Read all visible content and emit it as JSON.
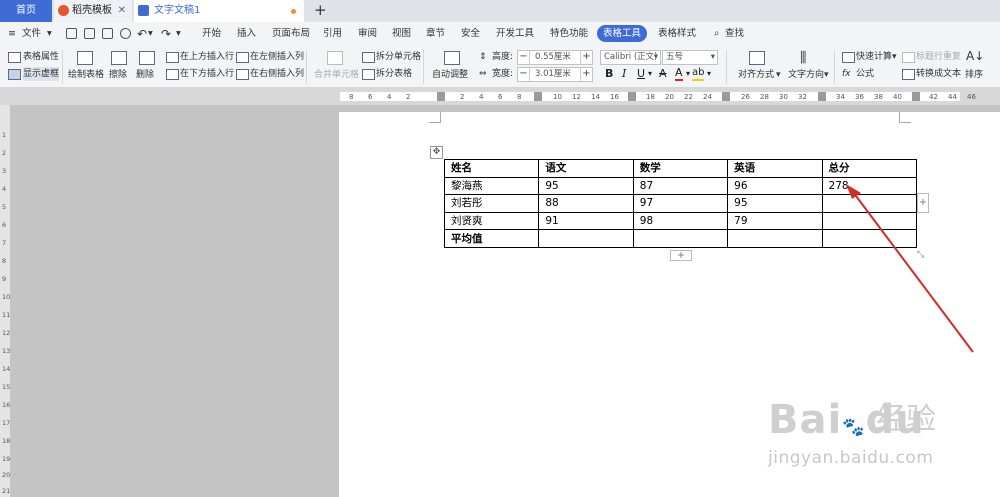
{
  "tabs": {
    "home": "首页",
    "template": "稻壳模板",
    "doc": "文字文稿1"
  },
  "menu": {
    "file": "文件",
    "items": [
      "开始",
      "插入",
      "页面布局",
      "引用",
      "审阅",
      "视图",
      "章节",
      "安全",
      "开发工具",
      "特色功能",
      "表格工具",
      "表格样式"
    ],
    "search": "查找"
  },
  "ribbon": {
    "table_props": "表格属性",
    "show_grid": "显示虚框",
    "draw_table": "绘制表格",
    "erase": "擦除",
    "delete": "删除",
    "insert_above": "在上方插入行",
    "insert_below": "在下方插入行",
    "insert_left": "在左侧插入列",
    "insert_right": "在右侧插入列",
    "merge_cells": "合并单元格",
    "split_cells": "拆分单元格",
    "split_table": "拆分表格",
    "auto_fit": "自动调整",
    "height_label": "高度:",
    "height_value": "0.55厘米",
    "width_label": "宽度:",
    "width_value": "3.01厘米",
    "font_name": "Calibri (正文)",
    "font_size": "五号",
    "align": "对齐方式",
    "text_direction": "文字方向",
    "quick_calc": "快速计算",
    "repeat_header": "标题行重复",
    "formula": "公式",
    "convert_text": "转换成文本",
    "sort": "排序"
  },
  "ruler": {
    "labels": [
      "8",
      "6",
      "4",
      "2",
      "2",
      "4",
      "6",
      "8",
      "10",
      "12",
      "14",
      "16",
      "18",
      "20",
      "22",
      "24",
      "26",
      "28",
      "30",
      "32",
      "34",
      "36",
      "38",
      "40",
      "42",
      "44",
      "46"
    ],
    "vlabels": [
      "1",
      "2",
      "3",
      "4",
      "5",
      "6",
      "7",
      "8",
      "9",
      "10",
      "11",
      "12",
      "13",
      "14",
      "15",
      "16",
      "17",
      "18",
      "19",
      "20",
      "21"
    ]
  },
  "table": {
    "headers": [
      "姓名",
      "语文",
      "数学",
      "英语",
      "总分"
    ],
    "rows": [
      [
        "黎海燕",
        "95",
        "87",
        "96",
        "278"
      ],
      [
        "刘若彤",
        "88",
        "97",
        "95",
        ""
      ],
      [
        "刘贤爽",
        "91",
        "98",
        "79",
        ""
      ],
      [
        "平均值",
        "",
        "",
        "",
        ""
      ]
    ]
  },
  "watermark": {
    "logo": "Bai",
    "logo2": "du",
    "cn": "经验",
    "url": "jingyan.baidu.com"
  },
  "colors": {
    "accent": "#3f6bd6",
    "arrow": "#d42a2a"
  }
}
